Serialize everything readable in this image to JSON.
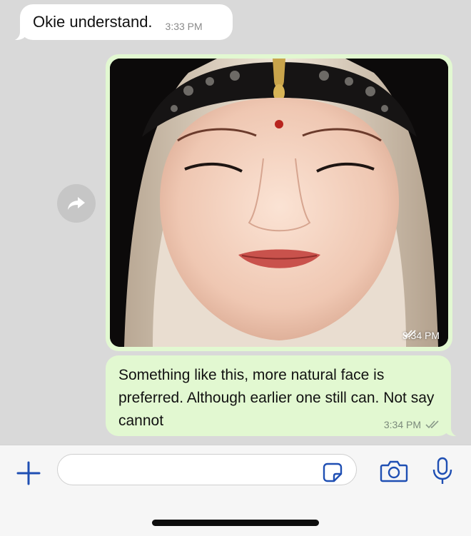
{
  "messages": [
    {
      "direction": "incoming",
      "text": "Okie understand.",
      "time": "3:33 PM"
    },
    {
      "direction": "outgoing",
      "type": "image",
      "time": "3:34 PM",
      "status": "read"
    },
    {
      "direction": "outgoing",
      "type": "text",
      "text": "Something like this, more natural face is preferred. Although earlier one still can. Not say cannot",
      "time": "3:34 PM",
      "status": "delivered"
    }
  ],
  "input": {
    "placeholder": ""
  },
  "icons": {
    "add": "plus-icon",
    "sticker": "sticker-icon",
    "camera": "camera-icon",
    "mic": "microphone-icon",
    "forward": "forward-arrow-icon",
    "checks": "double-check-icon"
  },
  "colors": {
    "chat_background": "#d9d9d9",
    "incoming_bubble": "#ffffff",
    "outgoing_bubble": "#e2f8d1",
    "accent_blue": "#1f4fb3"
  }
}
